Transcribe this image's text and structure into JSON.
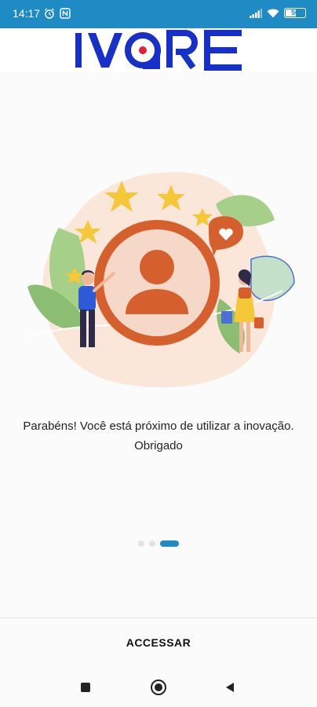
{
  "status_bar": {
    "time": "14:17",
    "battery_level": "56",
    "battery_fraction": 0.56,
    "icons": [
      "alarm-icon",
      "nfc-icon",
      "signal-icon",
      "wifi-icon",
      "battery-icon"
    ]
  },
  "header": {
    "logo_text": "IVORE",
    "logo_color": "#1730c9",
    "logo_dot_color": "#e0203c"
  },
  "onboarding": {
    "message": "Parabéns! Você está próximo de utilizar a inovação. Obrigado",
    "illustration_icon": "user-profile-with-stars-illustration",
    "page_count": 3,
    "active_page": 3
  },
  "actions": {
    "access_label": "ACCESSAR"
  },
  "nav_bar": {
    "icons": [
      "square-recents-icon",
      "circle-home-icon",
      "triangle-back-icon"
    ]
  },
  "colors": {
    "status_bar": "#1f8bc4",
    "accent": "#1f8bc4",
    "illustration_primary": "#d65f2e"
  }
}
